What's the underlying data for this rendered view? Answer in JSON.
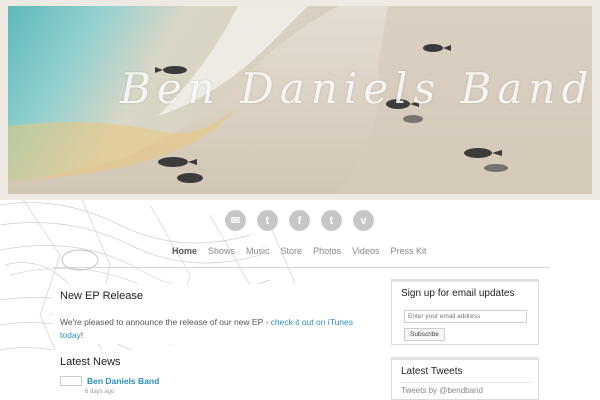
{
  "header": {
    "band_name": "Ben Daniels Band"
  },
  "social": [
    {
      "name": "email",
      "glyph": "✉"
    },
    {
      "name": "twitter",
      "glyph": "t"
    },
    {
      "name": "facebook",
      "glyph": "f"
    },
    {
      "name": "tumblr",
      "glyph": "t"
    },
    {
      "name": "vimeo",
      "glyph": "v"
    }
  ],
  "nav": {
    "items": [
      "Home",
      "Shows",
      "Music",
      "Store",
      "Photos",
      "Videos",
      "Press Kit"
    ],
    "active": "Home"
  },
  "ep_release": {
    "title": "New EP Release",
    "body_before": "We're pleased to announce the release of our new EP - ",
    "link_text": "check it out on iTunes today",
    "body_after": "!"
  },
  "news": {
    "title": "Latest News",
    "item_title": "Ben Daniels Band",
    "item_meta": "6 days ago"
  },
  "signup": {
    "title": "Sign up for email updates",
    "placeholder": "Enter your email address",
    "button": "Subscribe"
  },
  "tweets": {
    "title": "Latest Tweets",
    "link": "Tweets by @bendband"
  },
  "colors": {
    "accent_link": "#2a8fbf",
    "icon_gray": "#c7c7c7",
    "nav_gray": "#888888"
  }
}
